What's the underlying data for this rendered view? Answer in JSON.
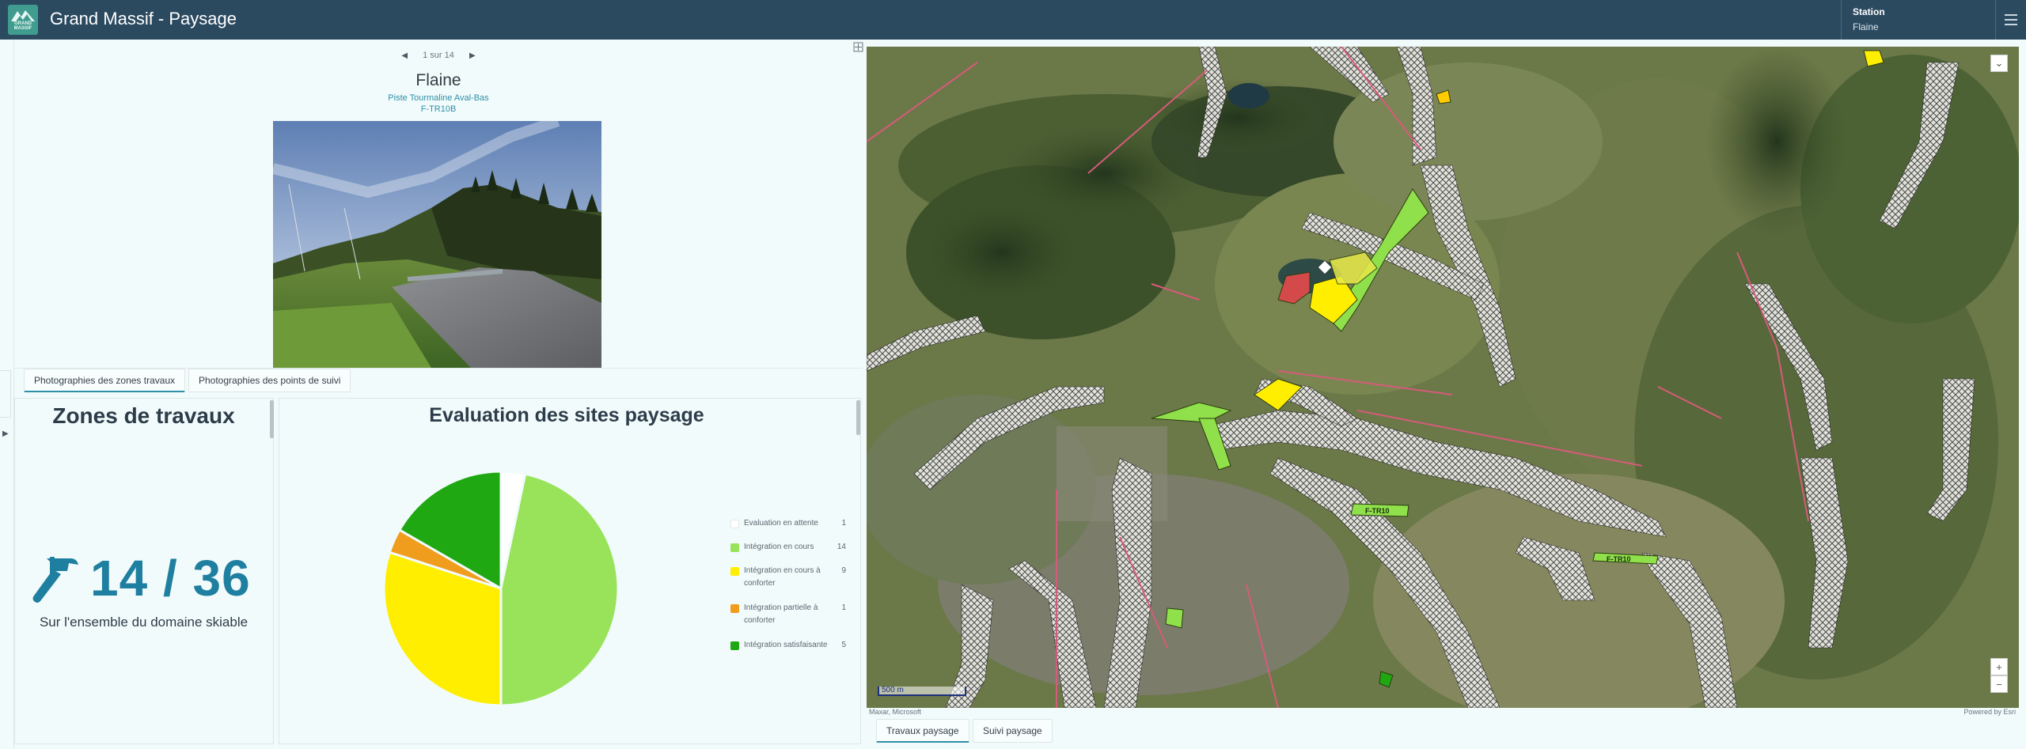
{
  "header": {
    "logo_text": "GRAND MASSIF",
    "title": "Grand Massif - Paysage",
    "station_label": "Station",
    "station_value": "Flaine"
  },
  "photo_panel": {
    "pager": "1 sur 14",
    "title": "Flaine",
    "subtitle": "Piste Tourmaline Aval-Bas",
    "code": "F-TR10B"
  },
  "panel_tabs": [
    {
      "label": "Photographies des zones travaux",
      "active": true
    },
    {
      "label": "Photographies des points de suivi",
      "active": false
    }
  ],
  "zones": {
    "title": "Zones de travaux",
    "count": "14 / 36",
    "caption": "Sur l'ensemble du domaine skiable"
  },
  "evaluation": {
    "title": "Evaluation des sites paysage"
  },
  "chart_data": {
    "type": "pie",
    "categories": [
      "Evaluation en attente",
      "Intégration en cours",
      "Intégration en cours à conforter",
      "Intégration partielle à conforter",
      "Intégration satisfaisante"
    ],
    "values": [
      1,
      14,
      9,
      1,
      5
    ],
    "colors": [
      "#ffffff",
      "#98e35a",
      "#ffee00",
      "#f09c1c",
      "#1fa812"
    ],
    "start": "top, clockwise"
  },
  "map": {
    "scale_label": "500 m",
    "attribution_left": "Maxar, Microsoft",
    "attribution_right": "Powered by Esri",
    "zoom_in": "+",
    "zoom_out": "−",
    "labels": [
      "F-TR10",
      "F-TR10"
    ]
  },
  "map_tabs": [
    {
      "label": "Travaux paysage",
      "active": true
    },
    {
      "label": "Suivi paysage",
      "active": false
    }
  ],
  "icons": {
    "prev": "◀",
    "next": "▶",
    "collapse": "▶",
    "expand_map": "⌄"
  }
}
